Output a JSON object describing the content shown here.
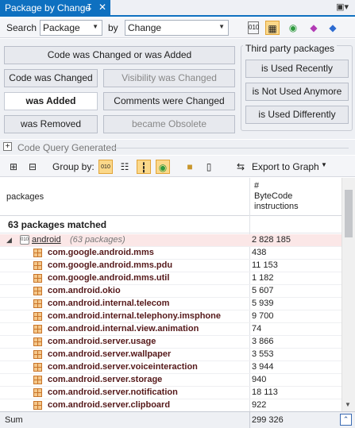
{
  "tab": {
    "title": "Package by Change",
    "pin": "↧",
    "close": "✕",
    "menu": "▣▾"
  },
  "search": {
    "search_label": "Search",
    "search_value": "Package",
    "by_label": "by",
    "by_value": "Change"
  },
  "queries": {
    "wide": "Code was Changed or was Added",
    "code_changed": "Code was Changed",
    "visibility_changed": "Visibility was Changed",
    "was_added": "was Added",
    "comments_changed": "Comments were Changed",
    "was_removed": "was Removed",
    "became_obsolete": "became Obsolete",
    "third_party_label": "Third party packages",
    "used_recently": "is Used Recently",
    "not_used_anymore": "is Not Used Anymore",
    "used_differently": "is Used Differently"
  },
  "code_query_generated": "Code Query Generated",
  "groupbar": {
    "group_by": "Group by:",
    "export": "Export to Graph"
  },
  "grid": {
    "col_packages": "packages",
    "col_bytecode": "#\nByteCode\ninstructions",
    "matched": "63 packages matched",
    "root": {
      "name": "android",
      "count": "(63 packages)",
      "value": "2 828 185"
    },
    "rows": [
      {
        "name": "com.google.android.mms",
        "value": "438"
      },
      {
        "name": "com.google.android.mms.pdu",
        "value": "11 153"
      },
      {
        "name": "com.google.android.mms.util",
        "value": "1 182"
      },
      {
        "name": "com.android.okio",
        "value": "5 607"
      },
      {
        "name": "com.android.internal.telecom",
        "value": "5 939"
      },
      {
        "name": "com.android.internal.telephony.imsphone",
        "value": "9 700"
      },
      {
        "name": "com.android.internal.view.animation",
        "value": "74"
      },
      {
        "name": "com.android.server.usage",
        "value": "3 866"
      },
      {
        "name": "com.android.server.wallpaper",
        "value": "3 553"
      },
      {
        "name": "com.android.server.voiceinteraction",
        "value": "3 944"
      },
      {
        "name": "com.android.server.storage",
        "value": "940"
      },
      {
        "name": "com.android.server.notification",
        "value": "18 113"
      },
      {
        "name": "com.android.server.clipboard",
        "value": "922"
      }
    ]
  },
  "sum": {
    "label": "Sum",
    "value": "299 326"
  }
}
